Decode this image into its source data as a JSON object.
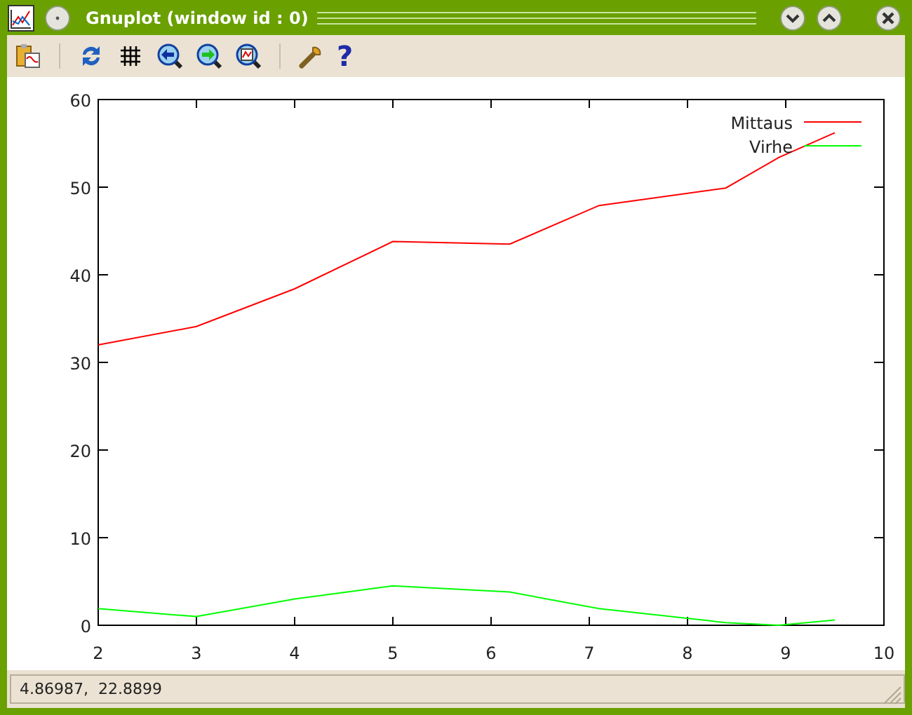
{
  "window": {
    "title": "Gnuplot (window id : 0)"
  },
  "toolbar": {
    "help_glyph": "?"
  },
  "plot": {
    "chart_data": {
      "type": "line",
      "x": [
        2,
        3,
        4,
        5,
        6.19,
        7.1,
        8.39,
        8.93,
        9.5
      ],
      "series": [
        {
          "name": "Mittaus",
          "color": "#ff0000",
          "values": [
            32,
            34.1,
            38.4,
            43.8,
            43.5,
            47.9,
            49.9,
            53.4,
            56.2
          ]
        },
        {
          "name": "Virhe",
          "color": "#00ff00",
          "values": [
            1.9,
            1,
            3,
            4.5,
            3.8,
            1.9,
            0.3,
            0,
            0.6
          ]
        }
      ],
      "legend": true,
      "xlim": [
        2,
        10
      ],
      "ylim": [
        0,
        60
      ],
      "xticks": [
        2,
        3,
        4,
        5,
        6,
        7,
        8,
        9,
        10
      ],
      "yticks": [
        0,
        10,
        20,
        30,
        40,
        50,
        60
      ]
    }
  },
  "status_bar": {
    "text": "4.86987,  22.8899"
  }
}
